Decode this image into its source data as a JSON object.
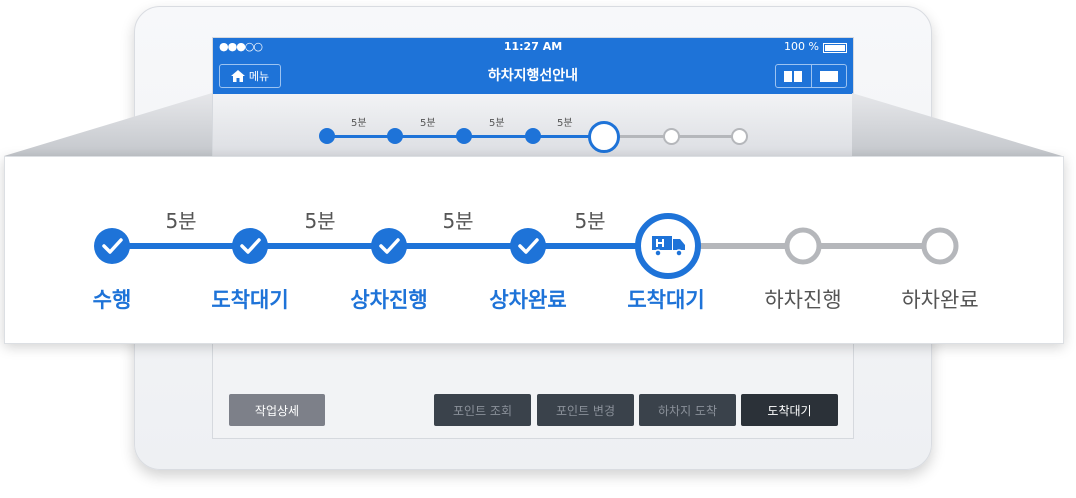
{
  "status_bar": {
    "signal": "●●●○○",
    "time": "11:27 AM",
    "battery": "100 %"
  },
  "header": {
    "menu_label": "메뉴",
    "title": "하차지행선안내"
  },
  "progress": {
    "current_index": 4,
    "steps": [
      {
        "label": "수행",
        "state": "done"
      },
      {
        "label": "도착대기",
        "state": "done"
      },
      {
        "label": "상차진행",
        "state": "done"
      },
      {
        "label": "상차완료",
        "state": "done"
      },
      {
        "label": "도착대기",
        "state": "current"
      },
      {
        "label": "하차진행",
        "state": "todo"
      },
      {
        "label": "하차완료",
        "state": "todo"
      }
    ],
    "durations": [
      "5분",
      "5분",
      "5분",
      "5분"
    ]
  },
  "footer": {
    "detail_button": "작업상세",
    "point_inquiry_button": "포인트 조회",
    "point_change_button": "포인트 변경",
    "unload_arrive_button": "하차지 도착",
    "arrival_wait_button": "도착대기"
  },
  "colors": {
    "primary": "#1e73d8",
    "inactive": "#b5b7bb",
    "dark_button": "#3a424b",
    "gray_button": "#7d8089"
  }
}
